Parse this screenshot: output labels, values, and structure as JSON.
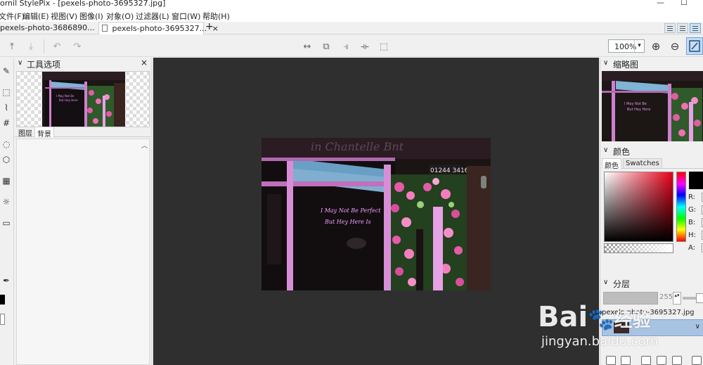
{
  "window": {
    "title": "ornil StylePix - [pexels-photo-3695327.jpg]",
    "controls": [
      "—",
      "☐"
    ]
  },
  "menu": [
    "文件(F)",
    "编辑(E)",
    "视图(V)",
    "图像(I)",
    "对象(O)",
    "过滤器(L)",
    "窗口(W)",
    "帮助(H)"
  ],
  "tabs": [
    {
      "label": "pexels-photo-3686890...",
      "active": false
    },
    {
      "label": "pexels-photo-3695327...",
      "active": true,
      "close": "×"
    }
  ],
  "new_tab": "+",
  "toolbar": {
    "zoom": "100%",
    "zoom_dropdown": "▾",
    "icons": [
      "upload-icon",
      "download-icon",
      "undo-icon",
      "redo-icon",
      "flip-horizontal-icon",
      "layers-icon",
      "align-icon",
      "distribute-icon",
      "crop-canvas-icon",
      "zoom-in-icon",
      "zoom-out-icon",
      "fit-window-icon"
    ]
  },
  "tool_options": {
    "title": "工具选项",
    "close": "×",
    "collapse": "∨",
    "subtabs": [
      "图层",
      "背景"
    ],
    "scroll_up": "︿"
  },
  "navigator": {
    "title": "缩略图",
    "collapse": "∨"
  },
  "color": {
    "title": "颜色",
    "collapse": "∨",
    "tabs": [
      "颜色",
      "Swatches"
    ],
    "channels": [
      "R:",
      "G:",
      "B:",
      "H:",
      "A:"
    ],
    "foreground": "#000000",
    "hue_top": "#ff0000"
  },
  "layers": {
    "title": "分层",
    "collapse": "∨",
    "opacity": "255",
    "layer_name": "pexels-photo-3695327.jpg",
    "row_dropdown": "∨"
  },
  "watermark": {
    "brand": "Bai",
    "brand_suffix": "经验",
    "url": "jingyan.baidu.com"
  },
  "photo_text": {
    "neon_line1": "I May Not Be Perfect",
    "neon_line2": "But Hey Here Is",
    "phone": "01244 34165",
    "shop_sign": "in Chantelle Bnt"
  }
}
